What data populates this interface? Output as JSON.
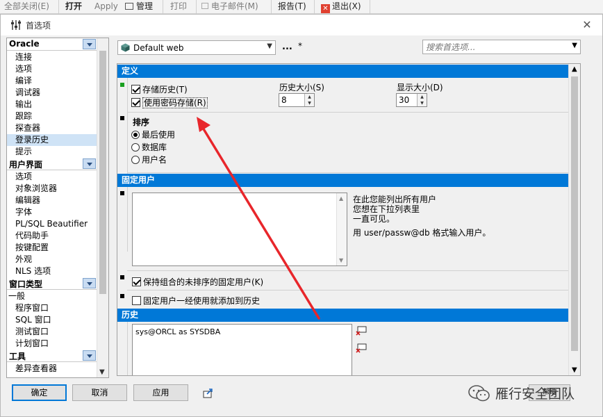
{
  "app_toolbar": {
    "items": [
      {
        "label": "全部关闭(E)",
        "enabled": false
      },
      {
        "label": "打开",
        "enabled": true
      },
      {
        "label": "Apply",
        "enabled": false
      },
      {
        "label": "管理",
        "enabled": true
      },
      {
        "label": "打印",
        "enabled": false
      },
      {
        "label": "电子邮件(M)",
        "enabled": false
      },
      {
        "label": "报告(T)",
        "enabled": true
      },
      {
        "label": "退出(X)",
        "enabled": true
      }
    ]
  },
  "dialog": {
    "title": "首选项",
    "close_glyph": "✕"
  },
  "nav": {
    "groups": [
      {
        "header": "Oracle",
        "items": [
          "连接",
          "选项",
          "编译",
          "调试器",
          "输出",
          "跟踪",
          "探查器",
          "登录历史",
          "提示"
        ],
        "selected": "登录历史"
      },
      {
        "header": "用户界面",
        "items": [
          "选项",
          "对象浏览器",
          "编辑器",
          "字体",
          "PL/SQL Beautifier",
          "代码助手",
          "按键配置",
          "外观",
          "NLS 选项"
        ]
      },
      {
        "header": "窗口类型",
        "items": [
          "一般",
          "程序窗口",
          "SQL 窗口",
          "测试窗口",
          "计划窗口"
        ]
      },
      {
        "header": "工具",
        "items": [
          "差异查看器"
        ]
      }
    ]
  },
  "topbar": {
    "profile": "Default web",
    "more": "...",
    "modified": "*",
    "search_placeholder": "搜索首选项..."
  },
  "sections": {
    "definition": {
      "header": "定义",
      "store_history_label": "存储历史(T)",
      "store_history_checked": true,
      "store_password_label": "使用密码存储(R)",
      "store_password_checked": true,
      "history_size_label": "历史大小(S)",
      "history_size_value": "8",
      "display_size_label": "显示大小(D)",
      "display_size_value": "30"
    },
    "sort": {
      "title": "排序",
      "options": [
        "最后使用",
        "数据库",
        "用户名"
      ],
      "selected": "最后使用"
    },
    "fixed_users": {
      "header": "固定用户",
      "hint_lines": [
        "在此您能列出所有用户",
        "您想在下拉列表里",
        "一直可见。"
      ],
      "format_hint": "用 user/passw@db 格式输入用户。",
      "keep_unsorted_label": "保持组合的未排序的固定用户(K)",
      "keep_unsorted_checked": true,
      "add_to_history_label": "固定用户一经使用就添加到历史",
      "add_to_history_checked": false
    },
    "history": {
      "header": "历史",
      "entries": [
        "sys@ORCL as SYSDBA"
      ]
    }
  },
  "buttons": {
    "ok": "确定",
    "cancel": "取消",
    "apply": "应用",
    "help": "帮助"
  },
  "watermark": "雁行安全团队",
  "colors": {
    "section_header": "#0078d7",
    "selection": "#cfe3f6",
    "annotation": "#e8262b"
  }
}
